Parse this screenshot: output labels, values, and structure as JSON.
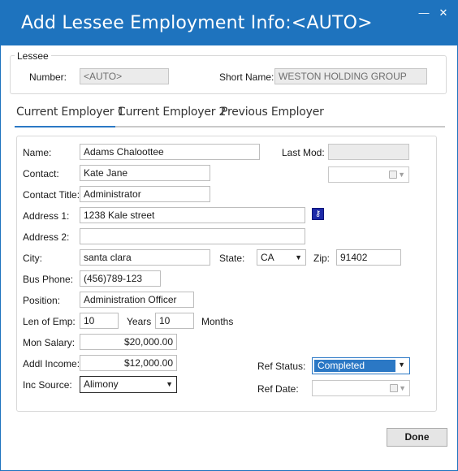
{
  "window": {
    "title": "Add Lessee Employment Info:<AUTO>",
    "minimize_glyph": "—",
    "close_glyph": "✕"
  },
  "lessee": {
    "legend": "Lessee",
    "number_label": "Number:",
    "number_value": "<AUTO>",
    "short_name_label": "Short Name:",
    "short_name_value": "WESTON HOLDING GROUP"
  },
  "tabs": [
    {
      "label": "Current Employer 1",
      "active": true
    },
    {
      "label": "Current Employer 2",
      "active": false
    },
    {
      "label": "Previous Employer",
      "active": false
    }
  ],
  "form": {
    "name_label": "Name:",
    "name_value": "Adams Chaloottee",
    "last_mod_label": "Last Mod:",
    "last_mod_value": "",
    "contact_label": "Contact:",
    "contact_value": "Kate Jane",
    "contact_title_label": "Contact Title:",
    "contact_title_value": "Administrator",
    "address1_label": "Address 1:",
    "address1_value": "1238 Kale street",
    "address2_label": "Address 2:",
    "address2_value": "",
    "city_label": "City:",
    "city_value": "santa clara",
    "state_label": "State:",
    "state_value": "CA",
    "zip_label": "Zip:",
    "zip_value": "91402",
    "bus_phone_label": "Bus Phone:",
    "bus_phone_value": "(456)789-123",
    "position_label": "Position:",
    "position_value": "Administration Officer",
    "len_emp_label": "Len of Emp:",
    "years_value": "10",
    "years_label": "Years",
    "months_value": "10",
    "months_label": "Months",
    "mon_salary_label": "Mon Salary:",
    "mon_salary_value": "$20,000.00",
    "addl_income_label": "Addl Income:",
    "addl_income_value": "$12,000.00",
    "inc_source_label": "Inc Source:",
    "inc_source_value": "Alimony",
    "ref_status_label": "Ref Status:",
    "ref_status_value": "Completed",
    "ref_date_label": "Ref Date:",
    "ref_date_value": ""
  },
  "buttons": {
    "done": "Done",
    "address_lookup_icon": "key-icon"
  },
  "colors": {
    "titlebar": "#1e73be",
    "accent": "#2b78c5",
    "lookup_button": "#1d2aa8"
  }
}
